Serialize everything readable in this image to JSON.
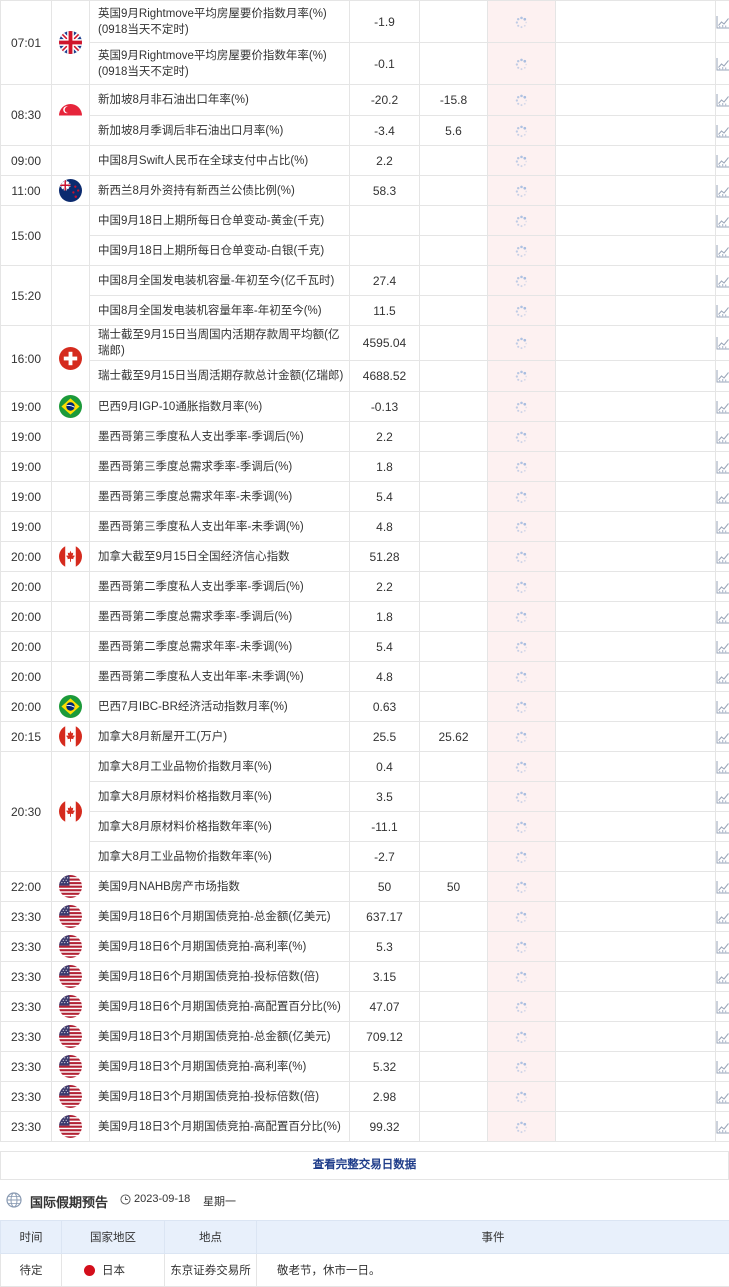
{
  "rows": [
    {
      "time": "07:01",
      "flag": "gb",
      "name": "英国9月Rightmove平均房屋要价指数月率(%) (0918当天不定时)",
      "prev": "-1.9",
      "pred": "",
      "actual": ""
    },
    {
      "time": "",
      "flag": "",
      "name": "英国9月Rightmove平均房屋要价指数年率(%) (0918当天不定时)",
      "prev": "-0.1",
      "pred": "",
      "actual": ""
    },
    {
      "time": "08:30",
      "flag": "sg",
      "name": "新加坡8月非石油出口年率(%)",
      "prev": "-20.2",
      "pred": "-15.8",
      "actual": ""
    },
    {
      "time": "",
      "flag": "",
      "name": "新加坡8月季调后非石油出口月率(%)",
      "prev": "-3.4",
      "pred": "5.6",
      "actual": ""
    },
    {
      "time": "09:00",
      "flag": "",
      "name": "中国8月Swift人民币在全球支付中占比(%)",
      "prev": "2.2",
      "pred": "",
      "actual": ""
    },
    {
      "time": "11:00",
      "flag": "nz",
      "name": "新西兰8月外资持有新西兰公债比例(%)",
      "prev": "58.3",
      "pred": "",
      "actual": ""
    },
    {
      "time": "15:00",
      "flag": "",
      "name": "中国9月18日上期所每日仓单变动-黄金(千克)",
      "prev": "",
      "pred": "",
      "actual": ""
    },
    {
      "time": "",
      "flag": "",
      "name": "中国9月18日上期所每日仓单变动-白银(千克)",
      "prev": "",
      "pred": "",
      "actual": ""
    },
    {
      "time": "15:20",
      "flag": "",
      "name": "中国8月全国发电装机容量-年初至今(亿千瓦时)",
      "prev": "27.4",
      "pred": "",
      "actual": ""
    },
    {
      "time": "",
      "flag": "",
      "name": "中国8月全国发电装机容量年率-年初至今(%)",
      "prev": "11.5",
      "pred": "",
      "actual": ""
    },
    {
      "time": "16:00",
      "flag": "ch",
      "name": "瑞士截至9月15日当周国内活期存款周平均额(亿瑞郎)",
      "prev": "4595.04",
      "pred": "",
      "actual": ""
    },
    {
      "time": "",
      "flag": "",
      "name": "瑞士截至9月15日当周活期存款总计金额(亿瑞郎)",
      "prev": "4688.52",
      "pred": "",
      "actual": ""
    },
    {
      "time": "19:00",
      "flag": "br",
      "name": "巴西9月IGP-10通胀指数月率(%)",
      "prev": "-0.13",
      "pred": "",
      "actual": ""
    },
    {
      "time": "19:00",
      "flag": "",
      "name": "墨西哥第三季度私人支出季率-季调后(%)",
      "prev": "2.2",
      "pred": "",
      "actual": ""
    },
    {
      "time": "19:00",
      "flag": "",
      "name": "墨西哥第三季度总需求季率-季调后(%)",
      "prev": "1.8",
      "pred": "",
      "actual": ""
    },
    {
      "time": "19:00",
      "flag": "",
      "name": "墨西哥第三季度总需求年率-未季调(%)",
      "prev": "5.4",
      "pred": "",
      "actual": ""
    },
    {
      "time": "19:00",
      "flag": "",
      "name": "墨西哥第三季度私人支出年率-未季调(%)",
      "prev": "4.8",
      "pred": "",
      "actual": ""
    },
    {
      "time": "20:00",
      "flag": "ca",
      "name": "加拿大截至9月15日全国经济信心指数",
      "prev": "51.28",
      "pred": "",
      "actual": ""
    },
    {
      "time": "20:00",
      "flag": "",
      "name": "墨西哥第二季度私人支出季率-季调后(%)",
      "prev": "2.2",
      "pred": "",
      "actual": ""
    },
    {
      "time": "20:00",
      "flag": "",
      "name": "墨西哥第二季度总需求季率-季调后(%)",
      "prev": "1.8",
      "pred": "",
      "actual": ""
    },
    {
      "time": "20:00",
      "flag": "",
      "name": "墨西哥第二季度总需求年率-未季调(%)",
      "prev": "5.4",
      "pred": "",
      "actual": ""
    },
    {
      "time": "20:00",
      "flag": "",
      "name": "墨西哥第二季度私人支出年率-未季调(%)",
      "prev": "4.8",
      "pred": "",
      "actual": ""
    },
    {
      "time": "20:00",
      "flag": "br",
      "name": "巴西7月IBC-BR经济活动指数月率(%)",
      "prev": "0.63",
      "pred": "",
      "actual": ""
    },
    {
      "time": "20:15",
      "flag": "ca",
      "name": "加拿大8月新屋开工(万户)",
      "prev": "25.5",
      "pred": "25.62",
      "actual": ""
    },
    {
      "time": "20:30",
      "flag": "ca",
      "name": "加拿大8月工业品物价指数月率(%)",
      "prev": "0.4",
      "pred": "",
      "actual": ""
    },
    {
      "time": "",
      "flag": "",
      "name": "加拿大8月原材料价格指数月率(%)",
      "prev": "3.5",
      "pred": "",
      "actual": ""
    },
    {
      "time": "",
      "flag": "",
      "name": "加拿大8月原材料价格指数年率(%)",
      "prev": "-11.1",
      "pred": "",
      "actual": ""
    },
    {
      "time": "",
      "flag": "",
      "name": "加拿大8月工业品物价指数年率(%)",
      "prev": "-2.7",
      "pred": "",
      "actual": ""
    },
    {
      "time": "22:00",
      "flag": "us",
      "name": "美国9月NAHB房产市场指数",
      "prev": "50",
      "pred": "50",
      "actual": ""
    },
    {
      "time": "23:30",
      "flag": "us",
      "name": "美国9月18日6个月期国债竞拍-总金额(亿美元)",
      "prev": "637.17",
      "pred": "",
      "actual": ""
    },
    {
      "time": "23:30",
      "flag": "us",
      "name": "美国9月18日6个月期国债竞拍-高利率(%)",
      "prev": "5.3",
      "pred": "",
      "actual": ""
    },
    {
      "time": "23:30",
      "flag": "us",
      "name": "美国9月18日6个月期国债竞拍-投标倍数(倍)",
      "prev": "3.15",
      "pred": "",
      "actual": ""
    },
    {
      "time": "23:30",
      "flag": "us",
      "name": "美国9月18日6个月期国债竞拍-高配置百分比(%)",
      "prev": "47.07",
      "pred": "",
      "actual": ""
    },
    {
      "time": "23:30",
      "flag": "us",
      "name": "美国9月18日3个月期国债竞拍-总金额(亿美元)",
      "prev": "709.12",
      "pred": "",
      "actual": ""
    },
    {
      "time": "23:30",
      "flag": "us",
      "name": "美国9月18日3个月期国债竞拍-高利率(%)",
      "prev": "5.32",
      "pred": "",
      "actual": ""
    },
    {
      "time": "23:30",
      "flag": "us",
      "name": "美国9月18日3个月期国债竞拍-投标倍数(倍)",
      "prev": "2.98",
      "pred": "",
      "actual": ""
    },
    {
      "time": "23:30",
      "flag": "us",
      "name": "美国9月18日3个月期国债竞拍-高配置百分比(%)",
      "prev": "99.32",
      "pred": "",
      "actual": ""
    }
  ],
  "more_link": "查看完整交易日数据",
  "holiday": {
    "title": "国际假期预告",
    "date": "2023-09-18",
    "weekday": "星期一",
    "headers": [
      "时间",
      "国家地区",
      "地点",
      "事件"
    ],
    "rows": [
      {
        "time": "待定",
        "country": "日本",
        "place": "东京证券交易所",
        "event": "敬老节，休市一日。"
      }
    ]
  }
}
